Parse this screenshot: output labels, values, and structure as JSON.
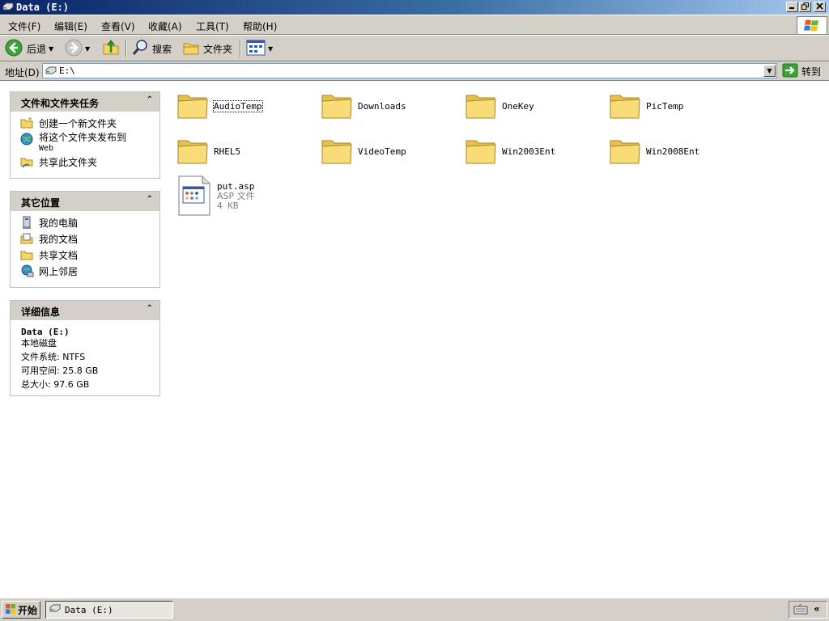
{
  "window": {
    "title": "Data (E:)"
  },
  "menu": [
    {
      "label": "文件(F)"
    },
    {
      "label": "编辑(E)"
    },
    {
      "label": "查看(V)"
    },
    {
      "label": "收藏(A)"
    },
    {
      "label": "工具(T)"
    },
    {
      "label": "帮助(H)"
    }
  ],
  "toolbar": {
    "back_label": "后退",
    "search_label": "搜索",
    "folders_label": "文件夹"
  },
  "address": {
    "label": "地址(D)",
    "value": "E:\\",
    "go_label": "转到"
  },
  "tasks_panel": {
    "title": "文件和文件夹任务",
    "items": [
      {
        "label": "创建一个新文件夹",
        "icon": "new-folder-icon"
      },
      {
        "label": "将这个文件夹发布到",
        "sublabel": "Web",
        "icon": "publish-web-icon"
      },
      {
        "label": "共享此文件夹",
        "icon": "share-folder-icon"
      }
    ]
  },
  "places_panel": {
    "title": "其它位置",
    "items": [
      {
        "label": "我的电脑",
        "icon": "my-computer-icon"
      },
      {
        "label": "我的文档",
        "icon": "my-documents-icon"
      },
      {
        "label": "共享文档",
        "icon": "shared-documents-icon"
      },
      {
        "label": "网上邻居",
        "icon": "network-places-icon"
      }
    ]
  },
  "details_panel": {
    "title": "详细信息",
    "name": "Data (E:)",
    "type": "本地磁盘",
    "filesystem": "文件系统: NTFS",
    "free": "可用空间: 25.8 GB",
    "total": "总大小: 97.6 GB"
  },
  "folders": [
    {
      "name": "AudioTemp"
    },
    {
      "name": "Downloads"
    },
    {
      "name": "OneKey"
    },
    {
      "name": "PicTemp"
    },
    {
      "name": "RHEL5"
    },
    {
      "name": "VideoTemp"
    },
    {
      "name": "Win2003Ent"
    },
    {
      "name": "Win2008Ent"
    }
  ],
  "file": {
    "name": "put.asp",
    "type": "ASP 文件",
    "size": "4 KB"
  },
  "taskbar": {
    "start_label": "开始",
    "task_label": "Data (E:)"
  },
  "colors": {
    "titlebar_start": "#0a246a",
    "titlebar_end": "#a6caf0",
    "chrome": "#d4d0c8",
    "folder": "#f5d46a"
  }
}
